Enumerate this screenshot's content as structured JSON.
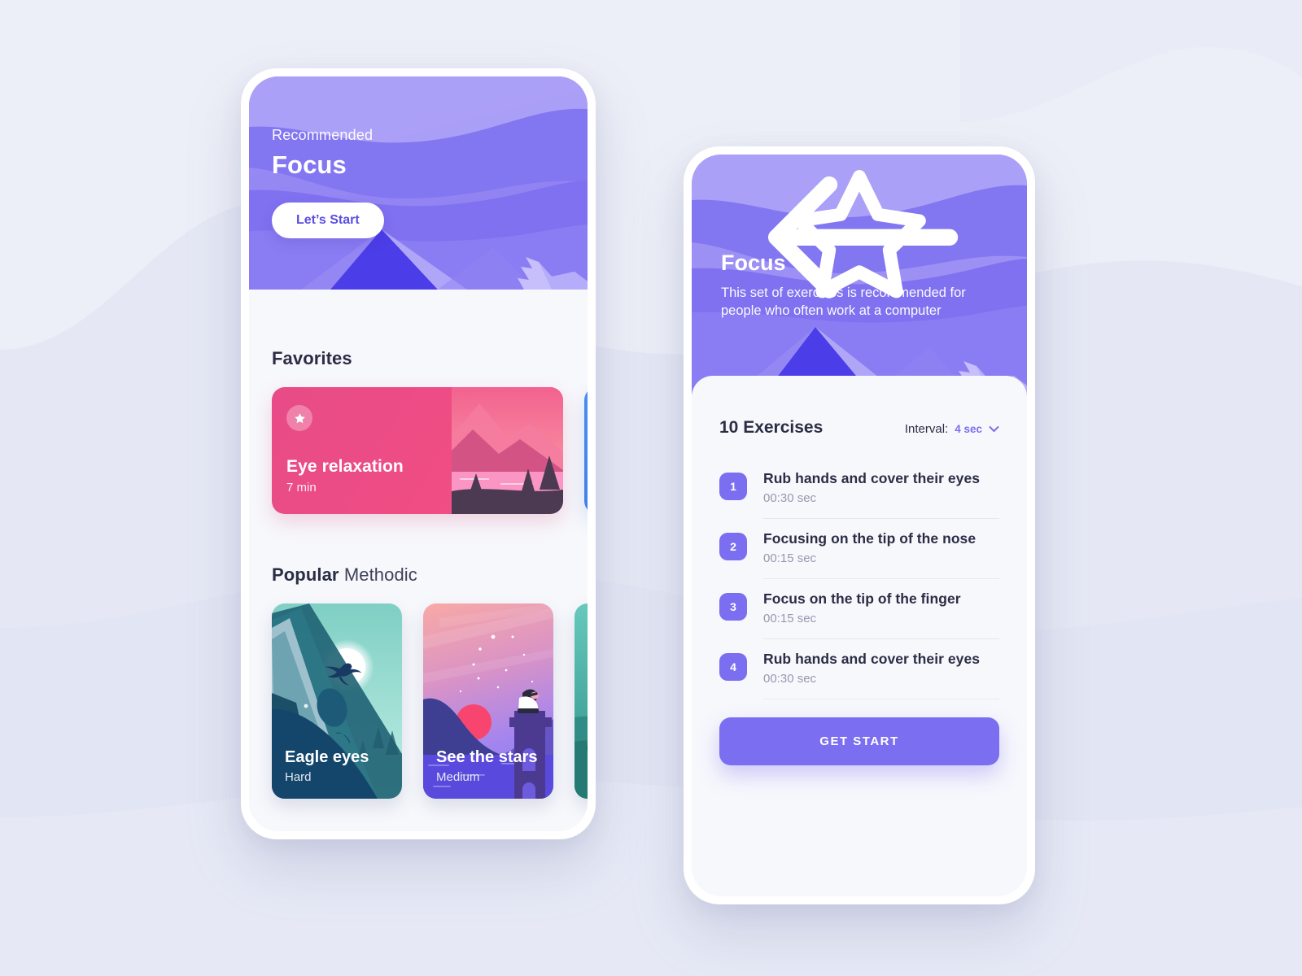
{
  "theme": {
    "accent": "#7b6ef0",
    "accent_dark": "#4b3de8",
    "accent_light": "#a89cf5",
    "page_bg": "#eceff7",
    "sheet_bg": "#f7f8fc",
    "text_dark": "#2b2d45",
    "text_muted": "#9599ae",
    "pink": "#ef4d84",
    "teal": "#6cccc0"
  },
  "home_screen": {
    "hero": {
      "kicker": "Recommended",
      "title": "Focus",
      "cta_label": "Let’s Start"
    },
    "favorites": {
      "section_title": "Favorites",
      "cards": [
        {
          "name": "Eye relaxation",
          "duration": "7 min",
          "starred": true,
          "color": "#ef4d84"
        },
        {
          "name": "",
          "duration": "",
          "starred": false,
          "color": "#4a8ef0"
        }
      ]
    },
    "popular": {
      "section_title_bold": "Popular",
      "section_title_light": "Methodic",
      "cards": [
        {
          "name": "Eagle eyes",
          "difficulty": "Hard",
          "art": "eagle-mountain"
        },
        {
          "name": "See the stars",
          "difficulty": "Medium",
          "art": "stargazer-tower"
        },
        {
          "name": "",
          "difficulty": "",
          "art": "teal-forest"
        }
      ]
    }
  },
  "detail_screen": {
    "header": {
      "back_icon": "arrow-left-icon",
      "favorite_icon": "star-outline-icon",
      "title": "Focus",
      "description": "This set of exercises is recommended for people who often work at a computer"
    },
    "exercises_header": {
      "count_label": "10 Exercises",
      "interval_label": "Interval:",
      "interval_value": "4 sec",
      "chevron_icon": "chevron-down-icon"
    },
    "exercises": [
      {
        "num": "1",
        "name": "Rub hands and cover their eyes",
        "duration": "00:30 sec"
      },
      {
        "num": "2",
        "name": "Focusing on the tip of the nose",
        "duration": "00:15 sec"
      },
      {
        "num": "3",
        "name": "Focus on the tip of the finger",
        "duration": "00:15 sec"
      },
      {
        "num": "4",
        "name": "Rub hands and cover their eyes",
        "duration": "00:30 sec"
      }
    ],
    "primary_action": "GET START"
  }
}
